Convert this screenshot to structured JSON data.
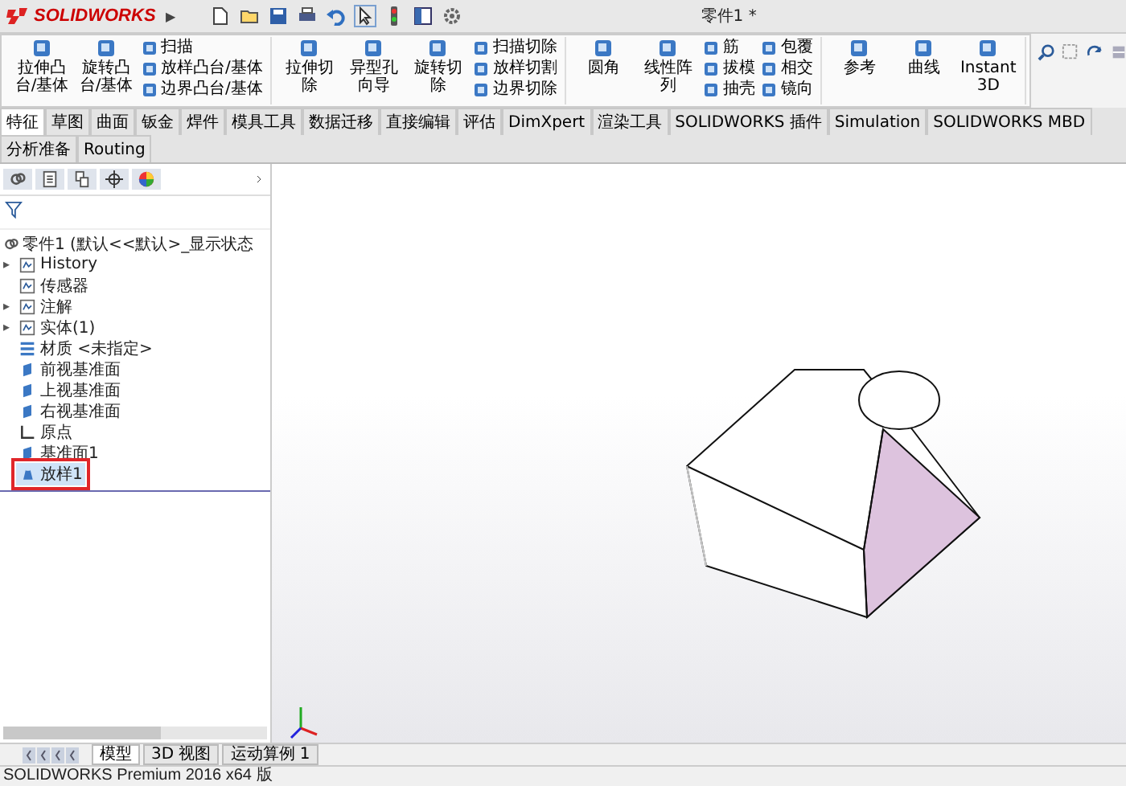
{
  "app": {
    "logo": "SOLIDWORKS",
    "menu_arrow": "▶",
    "title": "零件1 *"
  },
  "ribbon": {
    "groups": [
      {
        "items": [
          {
            "kind": "big",
            "label": "拉伸凸台/基体"
          },
          {
            "kind": "big",
            "label": "旋转凸台/基体"
          },
          {
            "kind": "small",
            "label": "扫描"
          },
          {
            "kind": "small",
            "label": "放样凸台/基体"
          },
          {
            "kind": "small",
            "label": "边界凸台/基体"
          }
        ]
      },
      {
        "items": [
          {
            "kind": "big",
            "label": "拉伸切除"
          },
          {
            "kind": "big",
            "label": "异型孔向导"
          },
          {
            "kind": "big",
            "label": "旋转切除"
          },
          {
            "kind": "small",
            "label": "扫描切除"
          },
          {
            "kind": "small",
            "label": "放样切割"
          },
          {
            "kind": "small",
            "label": "边界切除"
          }
        ]
      },
      {
        "items": [
          {
            "kind": "big",
            "label": "圆角"
          },
          {
            "kind": "big",
            "label": "线性阵列"
          },
          {
            "kind": "small",
            "label": "筋"
          },
          {
            "kind": "small",
            "label": "拔模"
          },
          {
            "kind": "small",
            "label": "抽壳"
          },
          {
            "kind": "small",
            "label": "包覆"
          },
          {
            "kind": "small",
            "label": "相交"
          },
          {
            "kind": "small",
            "label": "镜向"
          }
        ]
      },
      {
        "items": [
          {
            "kind": "big",
            "label": "参考"
          },
          {
            "kind": "big",
            "label": "曲线"
          },
          {
            "kind": "big",
            "label": "Instant3D"
          }
        ]
      }
    ]
  },
  "tabs": [
    {
      "label": "特征",
      "selected": true
    },
    {
      "label": "草图",
      "selected": false
    },
    {
      "label": "曲面",
      "selected": false
    },
    {
      "label": "钣金",
      "selected": false
    },
    {
      "label": "焊件",
      "selected": false
    },
    {
      "label": "模具工具",
      "selected": false
    },
    {
      "label": "数据迁移",
      "selected": false
    },
    {
      "label": "直接编辑",
      "selected": false
    },
    {
      "label": "评估",
      "selected": false
    },
    {
      "label": "DimXpert",
      "selected": false
    },
    {
      "label": "渲染工具",
      "selected": false
    },
    {
      "label": "SOLIDWORKS 插件",
      "selected": false
    },
    {
      "label": "Simulation",
      "selected": false
    },
    {
      "label": "SOLIDWORKS MBD",
      "selected": false
    },
    {
      "label": "分析准备",
      "selected": false
    },
    {
      "label": "Routing",
      "selected": false
    }
  ],
  "feature_tree": {
    "root": "零件1 (默认<<默认>_显示状态",
    "items": [
      {
        "label": "History",
        "kind": "folder",
        "toggle": "▸",
        "selected": false
      },
      {
        "label": "传感器",
        "kind": "folder",
        "selected": false
      },
      {
        "label": "注解",
        "kind": "folder",
        "toggle": "▸",
        "selected": false
      },
      {
        "label": "实体(1)",
        "kind": "folder",
        "toggle": "▸",
        "selected": false
      },
      {
        "label": "材质 <未指定>",
        "kind": "material",
        "selected": false
      },
      {
        "label": "前视基准面",
        "kind": "plane",
        "selected": false
      },
      {
        "label": "上视基准面",
        "kind": "plane",
        "selected": false
      },
      {
        "label": "右视基准面",
        "kind": "plane",
        "selected": false
      },
      {
        "label": "原点",
        "kind": "origin",
        "selected": false
      },
      {
        "label": "基准面1",
        "kind": "plane",
        "selected": false
      },
      {
        "label": "放样1",
        "kind": "feature",
        "selected": true
      }
    ]
  },
  "bottom_tabs": [
    {
      "label": "模型",
      "selected": true
    },
    {
      "label": "3D 视图",
      "selected": false
    },
    {
      "label": "运动算例 1",
      "selected": false
    }
  ],
  "status_bar": "SOLIDWORKS Premium 2016 x64 版"
}
